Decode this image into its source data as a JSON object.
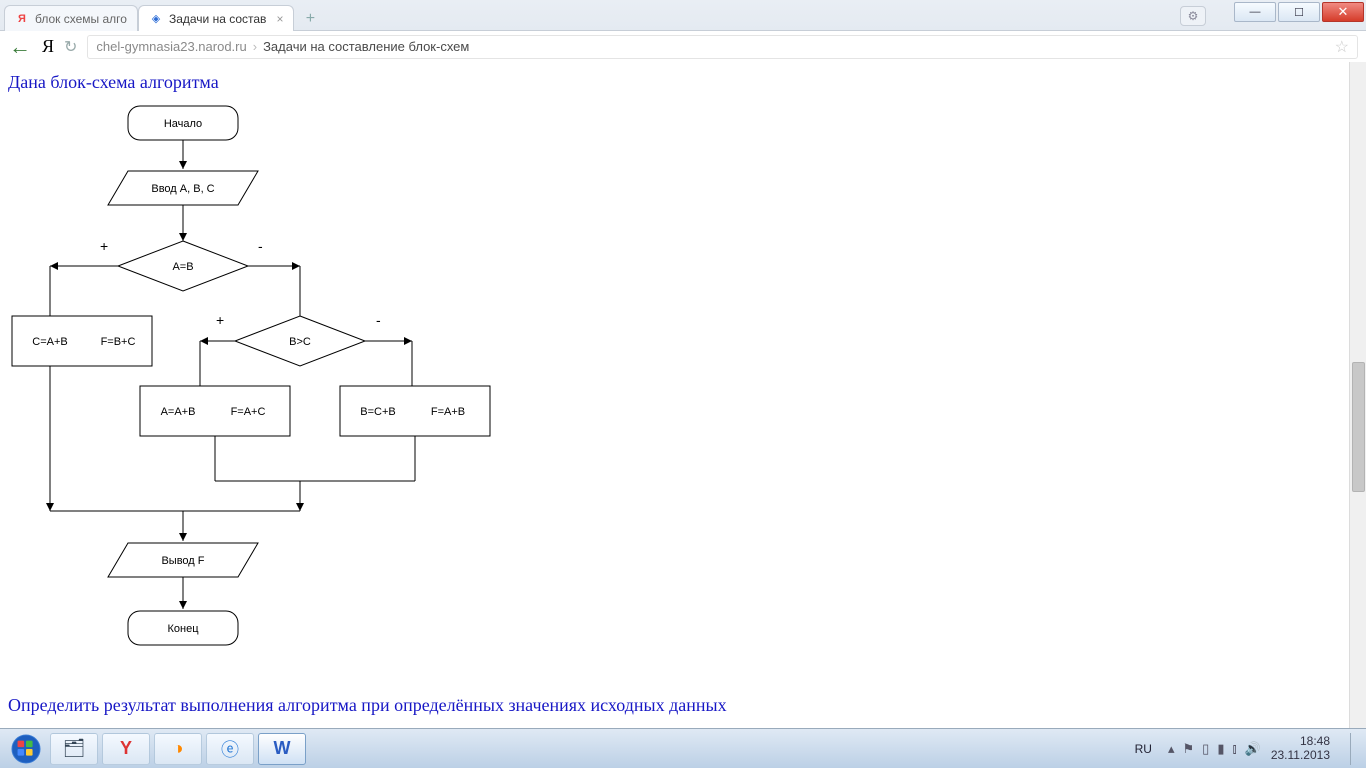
{
  "browser": {
    "tabs": [
      {
        "label": "блок схемы алго",
        "favicon": "Я",
        "favicon_kind": "y"
      },
      {
        "label": "Задачи на состав",
        "favicon": "◈",
        "favicon_kind": "o"
      }
    ],
    "address": {
      "host": "chel-gymnasia23.narod.ru",
      "separator": "›",
      "crumb": "Задачи на составление блок-схем"
    },
    "window": {
      "min": "—",
      "max": "☐",
      "close": "✕"
    }
  },
  "page": {
    "heading": "Дана блок-схема алгоритма",
    "bottom_heading": "Определить результат выполнения алгоритма при определённых значениях исходных данных"
  },
  "flow": {
    "start": "Начало",
    "input": "Ввод A, B, C",
    "cond1": "A=B",
    "cond2": "B>C",
    "plus": "+",
    "minus": "-",
    "box_left_a": "C=A+B",
    "box_left_b": "F=B+C",
    "box_mid_a": "A=A+B",
    "box_mid_b": "F=A+C",
    "box_right_a": "B=C+B",
    "box_right_b": "F=A+B",
    "output": "Вывод F",
    "end": "Конец"
  },
  "taskbar": {
    "lang": "RU",
    "time": "18:48",
    "date": "23.11.2013"
  }
}
